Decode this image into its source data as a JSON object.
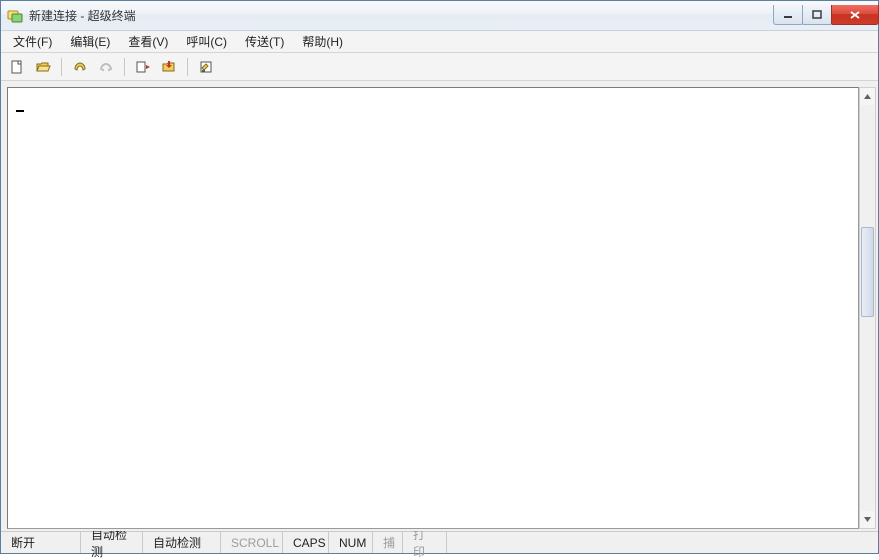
{
  "title": "新建连接 - 超级终端",
  "menu": {
    "items": [
      {
        "label": "文件(F)"
      },
      {
        "label": "编辑(E)"
      },
      {
        "label": "查看(V)"
      },
      {
        "label": "呼叫(C)"
      },
      {
        "label": "传送(T)"
      },
      {
        "label": "帮助(H)"
      }
    ]
  },
  "toolbar": {
    "buttons": [
      {
        "name": "new-icon"
      },
      {
        "name": "open-icon"
      },
      {
        "name": "call-icon"
      },
      {
        "name": "disconnect-icon"
      },
      {
        "name": "send-icon"
      },
      {
        "name": "receive-icon"
      },
      {
        "name": "properties-icon"
      }
    ]
  },
  "terminal": {
    "content": ""
  },
  "status": {
    "panes": [
      {
        "label": "断开",
        "disabled": false,
        "width": 80
      },
      {
        "label": "自动检测",
        "disabled": false,
        "width": 62
      },
      {
        "label": "自动检测",
        "disabled": false,
        "width": 78
      },
      {
        "label": "SCROLL",
        "disabled": true,
        "width": 62
      },
      {
        "label": "CAPS",
        "disabled": false,
        "width": 46
      },
      {
        "label": "NUM",
        "disabled": false,
        "width": 44
      },
      {
        "label": "捕",
        "disabled": true,
        "width": 30
      },
      {
        "label": "打印",
        "disabled": true,
        "width": 44
      }
    ]
  }
}
